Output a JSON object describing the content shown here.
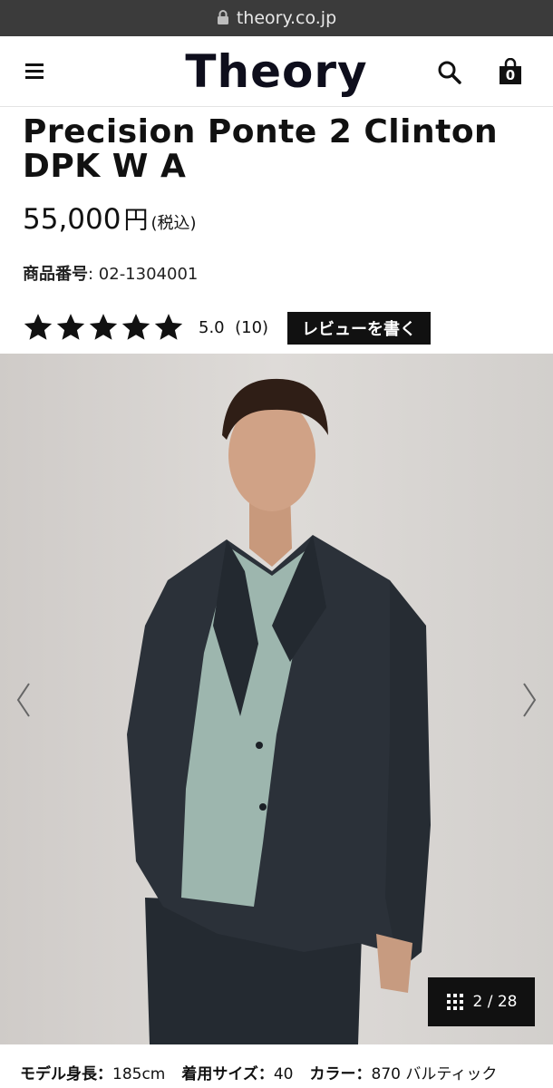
{
  "browser": {
    "url": "theory.co.jp"
  },
  "header": {
    "logo": "Theory",
    "cart_count": "0"
  },
  "product": {
    "title": "Precision Ponte 2 Clinton DPK W A",
    "price": "55,000",
    "currency": "円",
    "tax_note": "(税込)",
    "sku_label": "商品番号",
    "sku_value": ": 02-1304001",
    "rating": 5.0,
    "rating_text": "5.0",
    "review_count": "(10)",
    "review_button": "レビューを書く"
  },
  "gallery": {
    "counter": "2 / 28",
    "current": 2,
    "total": 28
  },
  "model_info": {
    "height_label": "モデル身長：",
    "height_value": "185cm",
    "size_label": "着用サイズ：",
    "size_value": "40",
    "color_label": "カラー：",
    "color_value": "870 バルティック"
  },
  "colors": {
    "jacket": "#2a3038",
    "tshirt": "#9fb8b0",
    "background": "#d8d5d2"
  }
}
